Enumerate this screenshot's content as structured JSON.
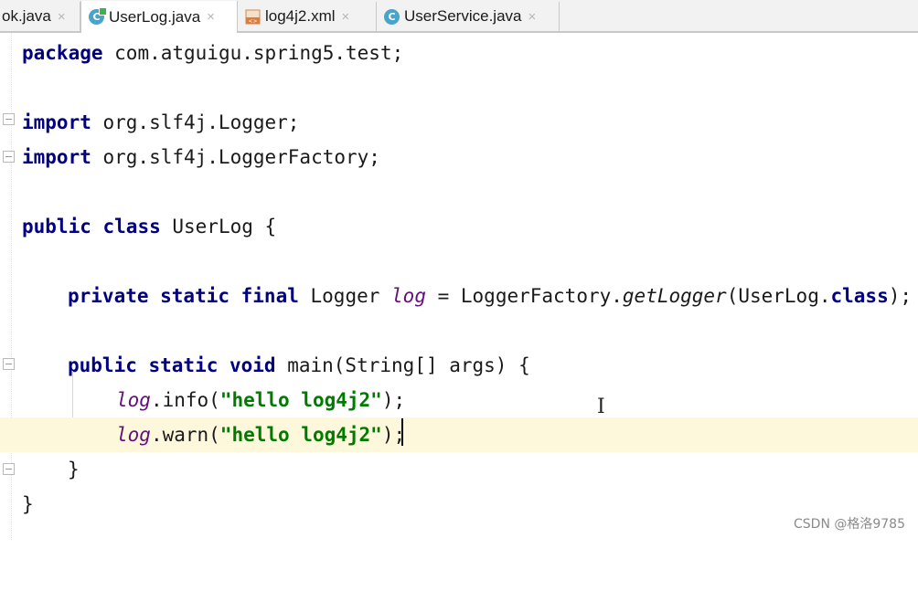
{
  "tabs": [
    {
      "label": "ok.java",
      "icon": "none",
      "active": false
    },
    {
      "label": "UserLog.java",
      "icon": "java-class-icon",
      "active": true
    },
    {
      "label": "log4j2.xml",
      "icon": "xml-file-icon",
      "active": false
    },
    {
      "label": "UserService.java",
      "icon": "java-class-icon",
      "active": false
    }
  ],
  "tab_icons": {
    "class_letter": "C",
    "close": "×"
  },
  "code": {
    "line1": {
      "kw": "package",
      "rest": " com.atguigu.spring5.test;"
    },
    "line2": {
      "kw": "import",
      "rest": " org.slf4j.Logger;"
    },
    "line3": {
      "kw": "import",
      "rest": " org.slf4j.LoggerFactory;"
    },
    "line4": {
      "kw1": "public",
      "kw2": "class",
      "rest": " UserLog {"
    },
    "line5": {
      "kw": "private static final",
      "type": " Logger ",
      "field": "log",
      "eq": " = LoggerFactory.",
      "fn": "getLogger",
      "arg_open": "(UserLog.",
      "kw_class": "class",
      "end": ");"
    },
    "line6": {
      "kw": "public static void",
      "rest": " main(String[] args) {"
    },
    "line7": {
      "field": "log",
      "call": ".info(",
      "str": "\"hello log4j2\"",
      "end": ");"
    },
    "line8": {
      "field": "log",
      "call": ".warn(",
      "str": "\"hello log4j2\"",
      "end": ");"
    },
    "line9": {
      "rest": "}"
    },
    "line10": {
      "rest": "}"
    }
  },
  "watermark": "CSDN @格洛9785",
  "colors": {
    "keyword": "#000080",
    "string": "#007a00",
    "field": "#660e7a",
    "current_line": "#fdf8dc"
  }
}
